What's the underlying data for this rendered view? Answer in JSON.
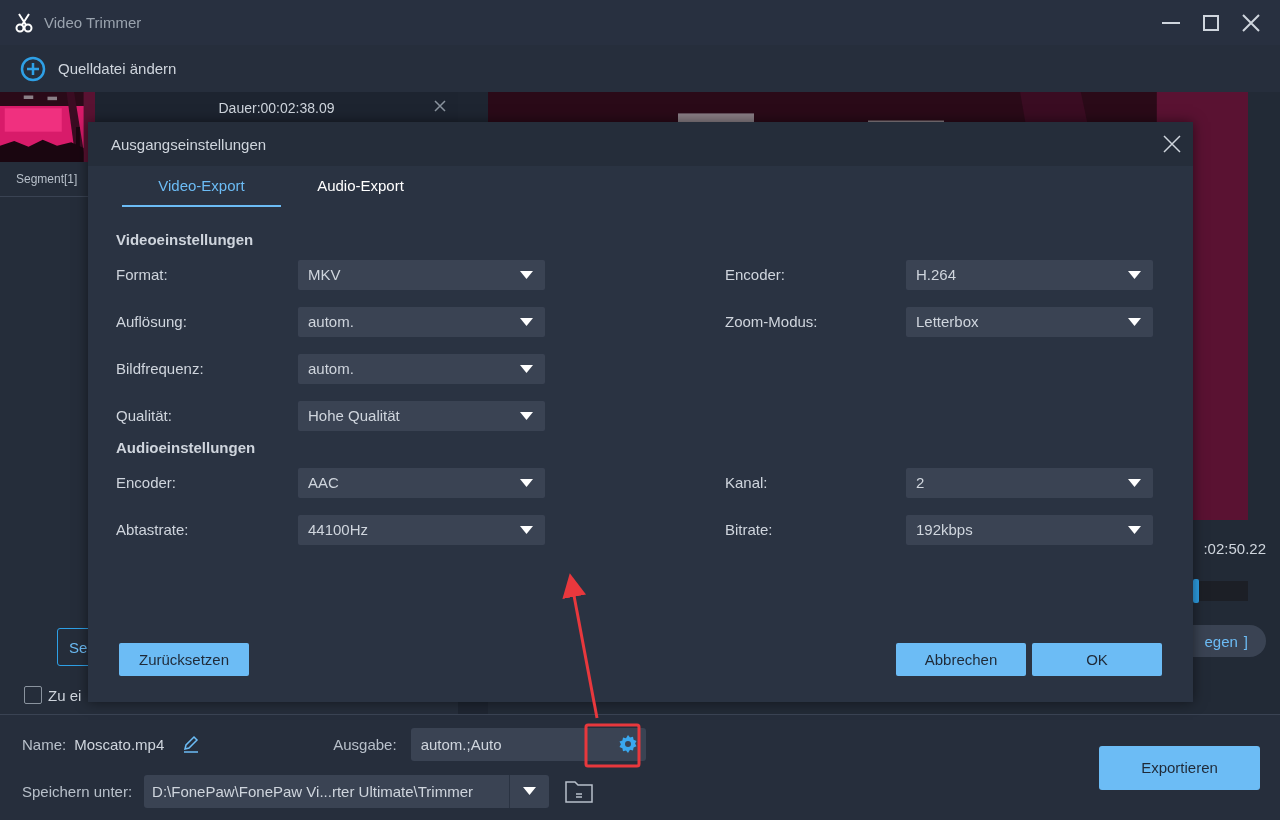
{
  "window": {
    "title": "Video Trimmer"
  },
  "toolbar": {
    "add_source": "Quelldatei ändern"
  },
  "segment": {
    "duration": "Dauer:00:02:38.09",
    "label": "Segment[1]"
  },
  "left_panel": {
    "segment_button": "Se",
    "merge": {
      "label": "Zu ei",
      "checked": false
    }
  },
  "preview": {
    "time": ":02:50.22",
    "pill": "egen",
    "pill_icon": "]"
  },
  "dialog": {
    "title": "Ausgangseinstellungen",
    "tabs": [
      {
        "label": "Video-Export",
        "selected": true
      },
      {
        "label": "Audio-Export",
        "selected": false
      }
    ],
    "sections": [
      {
        "heading": "Videoeinstellungen",
        "left": [
          {
            "label": "Format:",
            "value": "MKV"
          },
          {
            "label": "Auflösung:",
            "value": "autom."
          },
          {
            "label": "Bildfrequenz:",
            "value": "autom."
          },
          {
            "label": "Qualität:",
            "value": "Hohe Qualität"
          }
        ],
        "right": [
          {
            "label": "Encoder:",
            "value": "H.264"
          },
          {
            "label": "Zoom-Modus:",
            "value": "Letterbox"
          }
        ]
      },
      {
        "heading": "Audioeinstellungen",
        "left": [
          {
            "label": "Encoder:",
            "value": "AAC"
          },
          {
            "label": "Abtastrate:",
            "value": "44100Hz"
          }
        ],
        "right": [
          {
            "label": "Kanal:",
            "value": "2"
          },
          {
            "label": "Bitrate:",
            "value": "192kbps"
          }
        ]
      }
    ],
    "reset": "Zurücksetzen",
    "cancel": "Abbrechen",
    "ok": "OK"
  },
  "bottom": {
    "name_label": "Name:",
    "name": "Moscato.mp4",
    "output_label": "Ausgabe:",
    "output": "autom.;Auto",
    "save_label": "Speichern unter:",
    "save_path": "D:\\FonePaw\\FonePaw Vi...rter Ultimate\\Trimmer",
    "export": "Exportieren"
  }
}
